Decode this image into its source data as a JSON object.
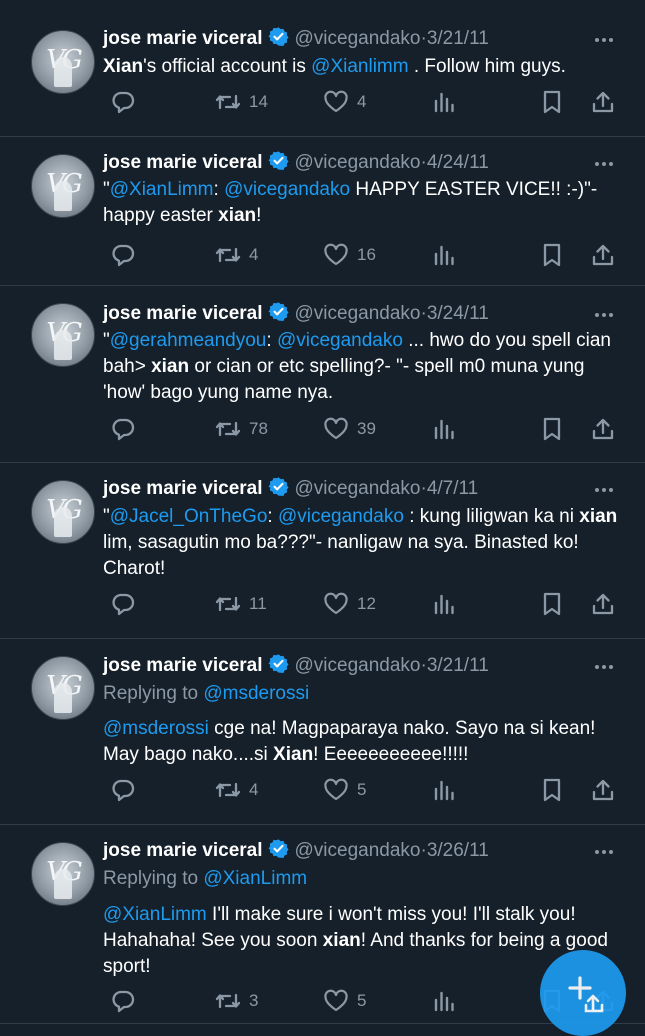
{
  "tweets": [
    {
      "name": "jose marie viceral",
      "handle": "@vicegandako",
      "sep": "·",
      "date": "3/21/11",
      "reply_prefix": "",
      "reply_handle": "",
      "segments": [
        {
          "t": "Xian",
          "s": "bold"
        },
        {
          "t": "'s official account is ",
          "s": "plain"
        },
        {
          "t": "@Xianlimm",
          "s": "mention"
        },
        {
          "t": " . Follow him guys.",
          "s": "plain"
        }
      ],
      "replies": "",
      "retweets": "14",
      "likes": "4"
    },
    {
      "name": "jose marie viceral",
      "handle": "@vicegandako",
      "sep": "·",
      "date": "4/24/11",
      "reply_prefix": "",
      "reply_handle": "",
      "segments": [
        {
          "t": "\"",
          "s": "plain"
        },
        {
          "t": "@XianLimm",
          "s": "mention"
        },
        {
          "t": ": ",
          "s": "plain"
        },
        {
          "t": "@vicegandako",
          "s": "mention"
        },
        {
          "t": " HAPPY EASTER VICE!! :-)\"- happy easter ",
          "s": "plain"
        },
        {
          "t": "xian",
          "s": "bold"
        },
        {
          "t": "!",
          "s": "plain"
        }
      ],
      "replies": "",
      "retweets": "4",
      "likes": "16"
    },
    {
      "name": "jose marie viceral",
      "handle": "@vicegandako",
      "sep": "·",
      "date": "3/24/11",
      "reply_prefix": "",
      "reply_handle": "",
      "segments": [
        {
          "t": "\"",
          "s": "plain"
        },
        {
          "t": "@gerahmeandyou",
          "s": "mention"
        },
        {
          "t": ": ",
          "s": "plain"
        },
        {
          "t": "@vicegandako",
          "s": "mention"
        },
        {
          "t": " ... hwo do you spell cian bah> ",
          "s": "plain"
        },
        {
          "t": "xian",
          "s": "bold"
        },
        {
          "t": " or cian or etc spelling?- \"- spell m0 muna yung 'how' bago yung name nya.",
          "s": "plain"
        }
      ],
      "replies": "",
      "retweets": "78",
      "likes": "39"
    },
    {
      "name": "jose marie viceral",
      "handle": "@vicegandako",
      "sep": "·",
      "date": "4/7/11",
      "reply_prefix": "",
      "reply_handle": "",
      "segments": [
        {
          "t": "\"",
          "s": "plain"
        },
        {
          "t": "@Jacel_OnTheGo",
          "s": "mention"
        },
        {
          "t": ": ",
          "s": "plain"
        },
        {
          "t": "@vicegandako",
          "s": "mention"
        },
        {
          "t": " : kung liligwan ka ni ",
          "s": "plain"
        },
        {
          "t": "xian",
          "s": "bold"
        },
        {
          "t": " lim, sasagutin mo ba???\"- nanligaw na sya. Binasted ko! Charot!",
          "s": "plain"
        }
      ],
      "replies": "",
      "retweets": "11",
      "likes": "12"
    },
    {
      "name": "jose marie viceral",
      "handle": "@vicegandako",
      "sep": "·",
      "date": "3/21/11",
      "reply_prefix": "Replying to ",
      "reply_handle": "@msderossi",
      "segments": [
        {
          "t": "@msderossi",
          "s": "mention"
        },
        {
          "t": " cge na! Magpaparaya nako. Sayo na si kean! May bago nako....si ",
          "s": "plain"
        },
        {
          "t": "Xian",
          "s": "bold"
        },
        {
          "t": "! Eeeeeeeeeee!!!!!",
          "s": "plain"
        }
      ],
      "replies": "",
      "retweets": "4",
      "likes": "5"
    },
    {
      "name": "jose marie viceral",
      "handle": "@vicegandako",
      "sep": "·",
      "date": "3/26/11",
      "reply_prefix": "Replying to ",
      "reply_handle": "@XianLimm",
      "segments": [
        {
          "t": "@XianLimm",
          "s": "mention"
        },
        {
          "t": " I'll make sure i won't miss you! I'll stalk you! Hahahaha! See you soon ",
          "s": "plain"
        },
        {
          "t": "xian",
          "s": "bold"
        },
        {
          "t": "! And thanks for being a good sport!",
          "s": "plain"
        }
      ],
      "replies": "",
      "retweets": "3",
      "likes": "5"
    }
  ],
  "icons": {
    "avatar": "VG",
    "more": "more-icon",
    "reply": "reply-icon",
    "retweet": "retweet-icon",
    "like": "heart-icon",
    "views": "views-icon",
    "bookmark": "bookmark-icon",
    "share": "share-icon",
    "compose": "compose-icon"
  },
  "colors": {
    "background": "#16202a",
    "accent": "#1d9bf0",
    "muted": "#8b98a5",
    "text": "#ffffff"
  }
}
